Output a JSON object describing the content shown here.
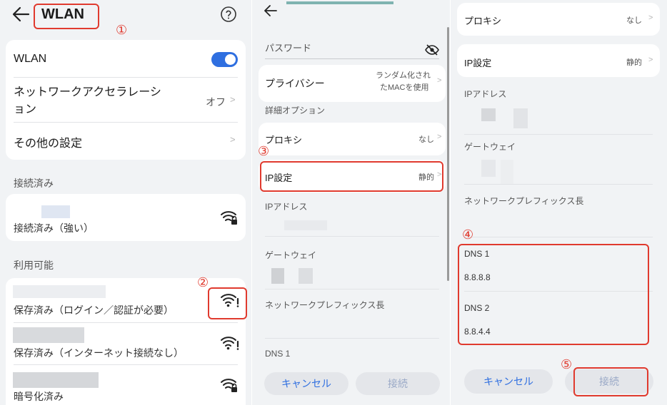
{
  "annotations": [
    "①",
    "②",
    "③",
    "④",
    "⑤"
  ],
  "panel1": {
    "title": "WLAN",
    "help_icon": "question-circle-icon",
    "settings": {
      "wlan_label": "WLAN",
      "wlan_toggle_on": true,
      "accel_label_line1": "ネットワークアクセラレーシ",
      "accel_label_line2": "ョン",
      "accel_value": "オフ",
      "other_label": "その他の設定"
    },
    "connected_section": "接続済み",
    "connected_status": "接続済み（強い）",
    "available_section": "利用可能",
    "networks": [
      {
        "status": "保存済み（ログイン／認証が必要）",
        "icon": "wifi-warning-icon"
      },
      {
        "status": "保存済み（インターネット接続なし）",
        "icon": "wifi-warning-icon"
      },
      {
        "status": "暗号化済み",
        "icon": "wifi-lock-icon"
      }
    ]
  },
  "panel2": {
    "password_label": "パスワード",
    "privacy_label": "プライバシー",
    "privacy_value_line1": "ランダム化され",
    "privacy_value_line2": "たMACを使用",
    "advanced_label": "詳細オプション",
    "proxy_label": "プロキシ",
    "proxy_value": "なし",
    "ip_label": "IP設定",
    "ip_value": "静的",
    "ip_address_label": "IPアドレス",
    "gateway_label": "ゲートウェイ",
    "prefix_label": "ネットワークプレフィックス長",
    "dns1_label": "DNS 1",
    "cancel": "キャンセル",
    "connect": "接続"
  },
  "panel3": {
    "proxy_label": "プロキシ",
    "proxy_value": "なし",
    "ip_label": "IP設定",
    "ip_value": "静的",
    "ip_address_label": "IPアドレス",
    "gateway_label": "ゲートウェイ",
    "prefix_label": "ネットワークプレフィックス長",
    "dns1_label": "DNS 1",
    "dns1_value": "8.8.8.8",
    "dns2_label": "DNS 2",
    "dns2_value": "8.8.4.4",
    "cancel": "キャンセル",
    "connect": "接続"
  },
  "colors": {
    "accent": "#2f6fe0",
    "annotation_red": "#e03a2e",
    "background": "#f1f3f5"
  }
}
